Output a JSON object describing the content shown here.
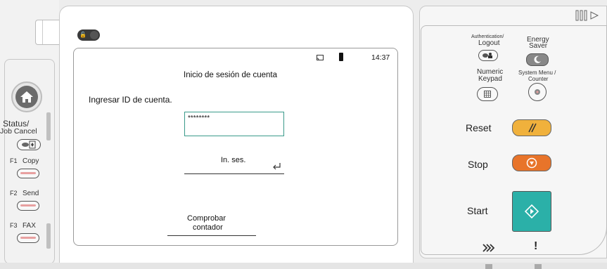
{
  "left": {
    "status_label": "Status/",
    "job_cancel_label": "Job Cancel",
    "f1_key": "F1",
    "f1_label": "Copy",
    "f2_key": "F2",
    "f2_label": "Send",
    "f3_key": "F3",
    "f3_label": "FAX"
  },
  "screen": {
    "time": "14:37",
    "title": "Inicio de sesión de cuenta",
    "prompt": "Ingresar ID de cuenta.",
    "account_id_value": "********",
    "login_button": "In. ses.",
    "check_counter_line1": "Comprobar",
    "check_counter_line2": "contador"
  },
  "right": {
    "auth_line1": "Authentication/",
    "auth_line2": "Logout",
    "energy_line1": "Energy",
    "energy_line2": "Saver",
    "numeric_line1": "Numeric",
    "numeric_line2": "Keypad",
    "sysmenu_line1": "System Menu /",
    "sysmenu_line2": "Counter",
    "reset_label": "Reset",
    "stop_label": "Stop",
    "start_label": "Start",
    "attention": "!"
  },
  "colors": {
    "reset": "#f0b13c",
    "stop": "#e8742a",
    "start": "#2bb0a8",
    "field_border": "#3a9a8a"
  }
}
